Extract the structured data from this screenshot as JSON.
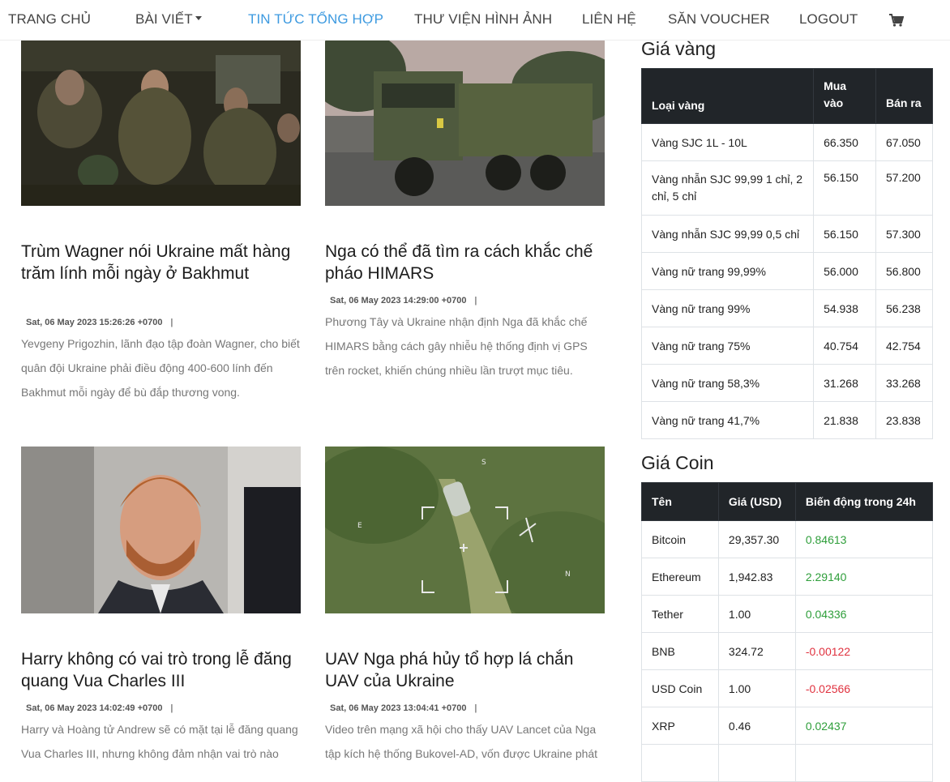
{
  "nav": {
    "items": [
      {
        "label": "TRANG CHỦ",
        "active": false
      },
      {
        "label": "BÀI VIẾT",
        "active": false,
        "dropdown": true
      },
      {
        "label": "TIN TỨC TỔNG HỢP",
        "active": true
      },
      {
        "label": "THƯ VIỆN HÌNH ẢNH",
        "active": false
      },
      {
        "label": "LIÊN HỆ",
        "active": false
      },
      {
        "label": "SĂN VOUCHER",
        "active": false
      },
      {
        "label": "LOGOUT",
        "active": false
      }
    ],
    "cart_icon": "shopping-cart-icon",
    "active_color": "#3d9ae0"
  },
  "articles": [
    {
      "title": "Trùm Wagner nói Ukraine mất hàng trăm lính mỗi ngày ở Bakhmut",
      "date": "Sat, 06 May 2023 15:26:26 +0700",
      "sep": "|",
      "excerpt": "Yevgeny Prigozhin, lãnh đạo tập đoàn Wagner, cho biết quân đội Ukraine phải điều động 400-600 lính đến Bakhmut mỗi ngày để bù đắp thương vong.",
      "image": "soldiers-in-vehicle-photo"
    },
    {
      "title": "Nga có thể đã tìm ra cách khắc chế pháo HIMARS",
      "date": "Sat, 06 May 2023 14:29:00 +0700",
      "sep": "|",
      "excerpt": "Phương Tây và Ukraine nhận định Nga đã khắc chế HIMARS bằng cách gây nhiễu hệ thống định vị GPS trên rocket, khiến chúng nhiều lần trượt mục tiêu.",
      "image": "himars-truck-photo"
    },
    {
      "title": "Harry không có vai trò trong lễ đăng quang Vua Charles III",
      "date": "Sat, 06 May 2023 14:02:49 +0700",
      "sep": "|",
      "excerpt": "Harry và Hoàng tử Andrew sẽ có mặt tại lễ đăng quang Vua Charles III, nhưng không đảm nhận vai trò nào",
      "image": "prince-harry-photo"
    },
    {
      "title": "UAV Nga phá hủy tổ hợp lá chắn UAV của Ukraine",
      "date": "Sat, 06 May 2023 13:04:41 +0700",
      "sep": "|",
      "excerpt": "Video trên mạng xã hội cho thấy UAV Lancet của Nga tập kích hệ thống Bukovel-AD, vốn được Ukraine phát",
      "image": "drone-footage-photo"
    }
  ],
  "gold": {
    "heading": "Giá vàng",
    "columns": [
      "Loại vàng",
      "Mua vào",
      "Bán ra"
    ],
    "rows": [
      [
        "Vàng SJC 1L - 10L",
        "66.350",
        "67.050"
      ],
      [
        "Vàng nhẫn SJC 99,99 1 chỉ, 2 chỉ, 5 chỉ",
        "56.150",
        "57.200"
      ],
      [
        "Vàng nhẫn SJC 99,99 0,5 chỉ",
        "56.150",
        "57.300"
      ],
      [
        "Vàng nữ trang 99,99%",
        "56.000",
        "56.800"
      ],
      [
        "Vàng nữ trang 99%",
        "54.938",
        "56.238"
      ],
      [
        "Vàng nữ trang 75%",
        "40.754",
        "42.754"
      ],
      [
        "Vàng nữ trang 58,3%",
        "31.268",
        "33.268"
      ],
      [
        "Vàng nữ trang 41,7%",
        "21.838",
        "23.838"
      ]
    ]
  },
  "coin": {
    "heading": "Giá Coin",
    "columns": [
      "Tên",
      "Giá (USD)",
      "Biến động trong 24h"
    ],
    "rows": [
      [
        "Bitcoin",
        "29,357.30",
        "0.84613"
      ],
      [
        "Ethereum",
        "1,942.83",
        "2.29140"
      ],
      [
        "Tether",
        "1.00",
        "0.04336"
      ],
      [
        "BNB",
        "324.72",
        "-0.00122"
      ],
      [
        "USD Coin",
        "1.00",
        "-0.02566"
      ],
      [
        "XRP",
        "0.46",
        "0.02437"
      ]
    ],
    "colors": {
      "up": "#2e9e3a",
      "down": "#e0323f"
    }
  }
}
